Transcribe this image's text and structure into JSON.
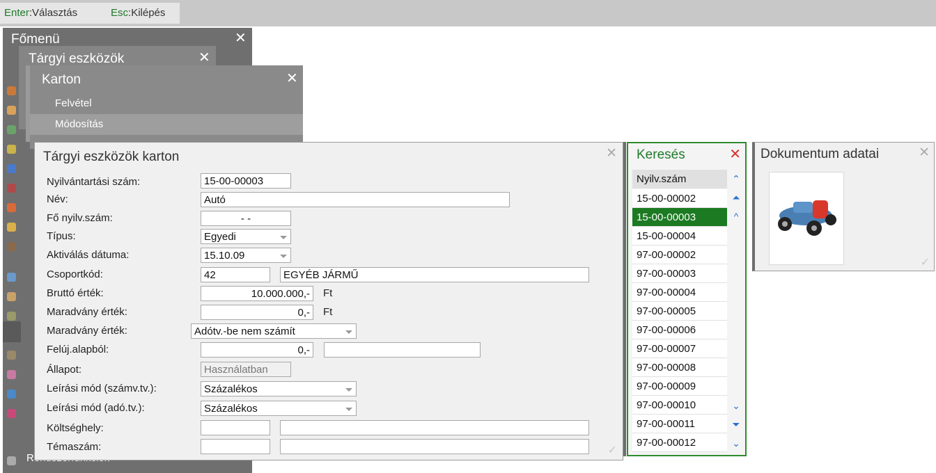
{
  "hints": [
    {
      "key": "Enter",
      "label": "Választás"
    },
    {
      "key": "Esc",
      "label": "Kilépés"
    }
  ],
  "menus": {
    "main": {
      "title": "Főmenü",
      "bottom_item": "Rendszerfunkciók"
    },
    "assets": {
      "title": "Tárgyi eszközök"
    },
    "karton": {
      "title": "Karton",
      "items": [
        "Felvétel",
        "Módosítás"
      ]
    }
  },
  "form": {
    "title": "Tárgyi eszközök karton",
    "fields": [
      {
        "label": "Nyilvántartási szám:",
        "value": "15-00-00003"
      },
      {
        "label": "Név:",
        "value": "Autó"
      },
      {
        "label": "Fő nyilv.szám:",
        "value": "- -"
      },
      {
        "label": "Típus:",
        "value": "Egyedi"
      },
      {
        "label": "Aktiválás dátuma:",
        "value": "15.10.09"
      },
      {
        "label": "Csoportkód:",
        "value": "42",
        "value2": "EGYÉB JÁRMŰ"
      },
      {
        "label": "Bruttó érték:",
        "value": "10.000.000,-",
        "unit": "Ft"
      },
      {
        "label": "Maradvány érték:",
        "value": "0,-",
        "unit": "Ft"
      },
      {
        "label": "Maradvány érték:",
        "value": "Adótv.-be nem számít"
      },
      {
        "label": "Felúj.alapból:",
        "value": "0,-",
        "value2": ""
      },
      {
        "label": "Állapot:",
        "value": "Használatban"
      },
      {
        "label": "Leírási mód (számv.tv.):",
        "value": "Százalékos"
      },
      {
        "label": "Leírási mód (adó.tv.):",
        "value": "Százalékos"
      },
      {
        "label": "Költséghely:",
        "value": "",
        "value2": ""
      },
      {
        "label": "Témaszám:",
        "value": "",
        "value2": ""
      }
    ]
  },
  "search": {
    "title": "Keresés",
    "column": "Nyilv.szám",
    "rows": [
      "15-00-00002",
      "15-00-00003",
      "15-00-00004",
      "97-00-00002",
      "97-00-00003",
      "97-00-00004",
      "97-00-00005",
      "97-00-00006",
      "97-00-00007",
      "97-00-00008",
      "97-00-00009",
      "97-00-00010",
      "97-00-00011",
      "97-00-00012"
    ],
    "selected": "15-00-00003"
  },
  "document": {
    "title": "Dokumentum adatai"
  },
  "colors": {
    "accent_green": "#1c7a22",
    "menu_gray": "#7c7c7c",
    "close_red": "#d43030",
    "nav_blue": "#2c6fd6"
  }
}
